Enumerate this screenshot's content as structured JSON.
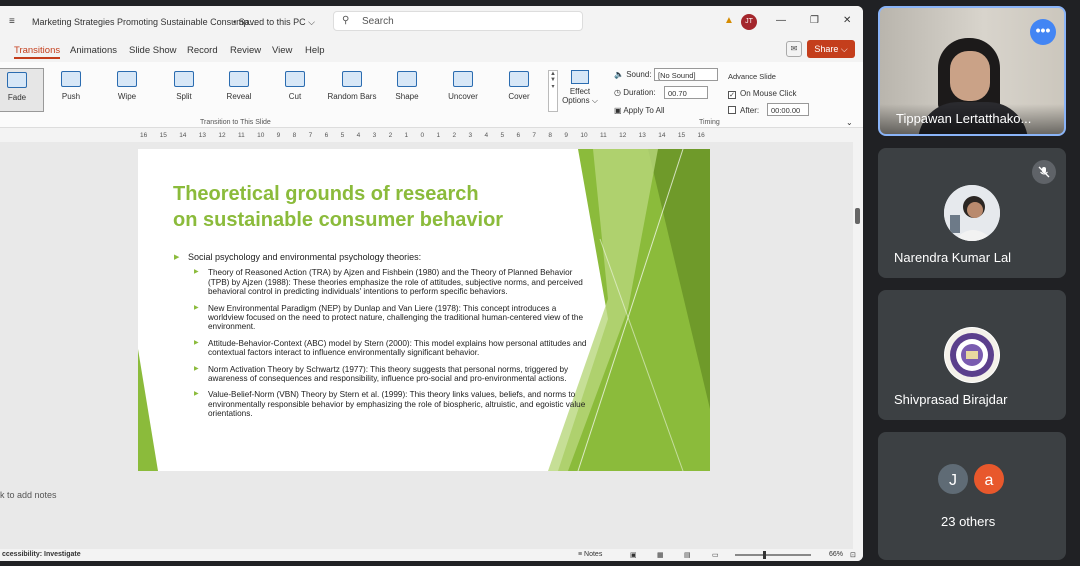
{
  "ppt": {
    "title": "Marketing Strategies Promoting Sustainable Consump...",
    "saved": "• Saved to this PC ⌵",
    "search_placeholder": "Search",
    "account_initials": "JT",
    "tabs": [
      "Transitions",
      "Animations",
      "Slide Show",
      "Record",
      "Review",
      "View",
      "Help"
    ],
    "share_label": "Share ⌵",
    "transitions": [
      "Fade",
      "Push",
      "Wipe",
      "Split",
      "Reveal",
      "Cut",
      "Random Bars",
      "Shape",
      "Uncover",
      "Cover"
    ],
    "effect_options": "Effect Options ⌵",
    "group_transition_label": "Transition to This Slide",
    "group_timing_label": "Timing",
    "sound_label": "Sound:",
    "sound_value": "[No Sound]",
    "duration_label": "Duration:",
    "duration_value": "00.70",
    "apply_all": "Apply To All",
    "advance_slide": "Advance Slide",
    "on_mouse_click": "On Mouse Click",
    "after_label": "After:",
    "after_value": "00:00.00",
    "ruler": [
      "16",
      "15",
      "14",
      "13",
      "12",
      "11",
      "10",
      "9",
      "8",
      "7",
      "6",
      "5",
      "4",
      "3",
      "2",
      "1",
      "0",
      "1",
      "2",
      "3",
      "4",
      "5",
      "6",
      "7",
      "8",
      "9",
      "10",
      "11",
      "12",
      "13",
      "14",
      "15",
      "16"
    ],
    "notes_placeholder": "k to add notes",
    "status_accessibility": "ccessibility: Investigate",
    "status_notes": "Notes",
    "zoom": "66%"
  },
  "slide": {
    "title_line1": "Theoretical grounds of research",
    "title_line2": "on sustainable consumer behavior",
    "main_bullet": "Social psychology and environmental psychology theories:",
    "sub_bullets": [
      "Theory of Reasoned Action (TRA) by Ajzen and Fishbein (1980) and the Theory of Planned Behavior (TPB) by Ajzen (1988): These theories emphasize the role of attitudes, subjective norms, and perceived behavioral control in predicting individuals' intentions to perform specific behaviors.",
      "New Environmental Paradigm (NEP) by Dunlap and Van Liere (1978): This concept introduces a worldview focused on the need to protect nature, challenging the traditional human-centered view of the environment.",
      "Attitude-Behavior-Context (ABC) model by Stern (2000): This model explains how personal attitudes and contextual factors interact to influence environmentally significant behavior.",
      "Norm Activation Theory by Schwartz (1977): This theory suggests that personal norms, triggered by awareness of consequences and responsibility, influence pro-social and pro-environmental actions.",
      "Value-Belief-Norm (VBN) Theory by Stern et al. (1999): This theory links values, beliefs, and norms to environmentally responsible behavior by emphasizing the role of biospheric, altruistic, and egoistic value orientations."
    ],
    "accent_color": "#8bbb3b"
  },
  "meeting": {
    "participants": [
      {
        "name": "Tippawan Lertatthako..."
      },
      {
        "name": "Narendra Kumar Lal"
      },
      {
        "name": "Shivprasad Birajdar"
      }
    ],
    "others_initials": [
      "J",
      "a"
    ],
    "others_label": "23 others"
  }
}
